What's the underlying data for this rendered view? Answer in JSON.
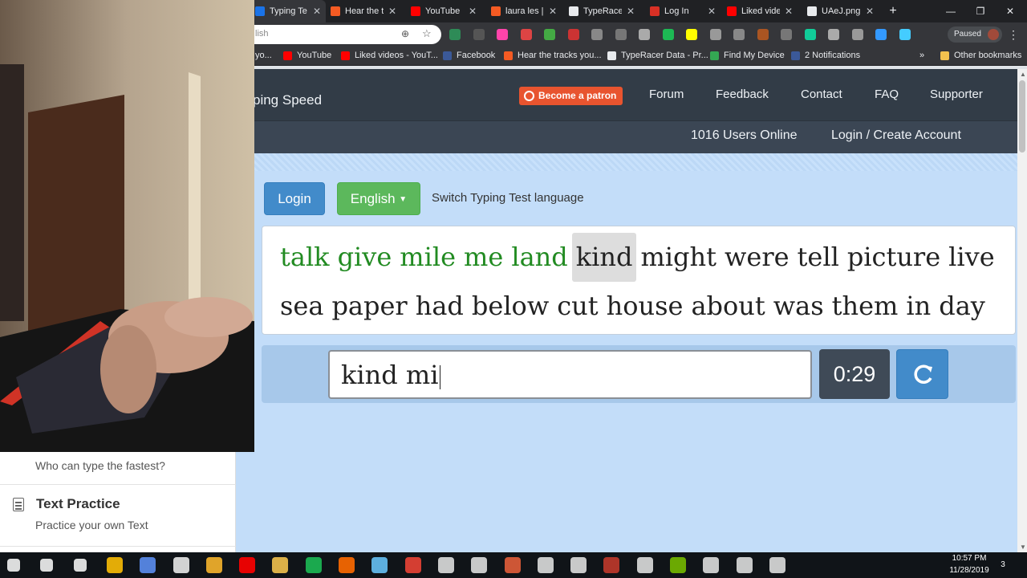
{
  "browser": {
    "tabs": [
      {
        "title": "Typing Te",
        "active": true,
        "color": "#1a73e8"
      },
      {
        "title": "Hear the t",
        "active": false,
        "color": "#f55b23"
      },
      {
        "title": "YouTube",
        "active": false,
        "color": "#ff0000"
      },
      {
        "title": "laura les |",
        "active": false,
        "color": "#f55b23"
      },
      {
        "title": "TypeRacer",
        "active": false,
        "color": "#e8eaed"
      },
      {
        "title": "Log In",
        "active": false,
        "color": "#d93025"
      },
      {
        "title": "Liked vide",
        "active": false,
        "color": "#ff0000"
      },
      {
        "title": "UAeJ.png",
        "active": false,
        "color": "#e8eaed"
      }
    ],
    "address_fragment": "lish",
    "profile_status": "Paused",
    "bookmarks": [
      {
        "label": "yo...",
        "color": "#ff0000"
      },
      {
        "label": "YouTube",
        "color": "#ff0000"
      },
      {
        "label": "Liked videos - YouT...",
        "color": "#ff0000"
      },
      {
        "label": "Facebook",
        "color": "#3b5998"
      },
      {
        "label": "Hear the tracks you...",
        "color": "#f55b23"
      },
      {
        "label": "TypeRacer Data - Pr...",
        "color": "#e8eaed"
      },
      {
        "label": "Find My Device",
        "color": "#34a853"
      },
      {
        "label": "2 Notifications",
        "color": "#3b5998"
      }
    ],
    "other_bookmarks": "Other bookmarks"
  },
  "site": {
    "brand": "ping Speed",
    "patron_label": "Become a patron",
    "nav": [
      "Forum",
      "Feedback",
      "Contact",
      "FAQ",
      "Supporter"
    ],
    "users_online": "1016 Users Online",
    "login_create": "Login / Create Account"
  },
  "controls": {
    "login_label": "Login",
    "language_label": "English",
    "language_note": "Switch Typing Test language"
  },
  "test": {
    "row1": [
      {
        "w": "talk",
        "s": "done"
      },
      {
        "w": "give",
        "s": "done"
      },
      {
        "w": "mile",
        "s": "done"
      },
      {
        "w": "me",
        "s": "done"
      },
      {
        "w": "land",
        "s": "done"
      },
      {
        "w": "kind",
        "s": "current"
      },
      {
        "w": "might",
        "s": "todo"
      },
      {
        "w": "were",
        "s": "todo"
      },
      {
        "w": "tell",
        "s": "todo"
      },
      {
        "w": "picture",
        "s": "todo"
      },
      {
        "w": "live",
        "s": "todo"
      }
    ],
    "row2": [
      {
        "w": "sea",
        "s": "todo"
      },
      {
        "w": "paper",
        "s": "todo"
      },
      {
        "w": "had",
        "s": "todo"
      },
      {
        "w": "below",
        "s": "todo"
      },
      {
        "w": "cut",
        "s": "todo"
      },
      {
        "w": "house",
        "s": "todo"
      },
      {
        "w": "about",
        "s": "todo"
      },
      {
        "w": "was",
        "s": "todo"
      },
      {
        "w": "them",
        "s": "todo"
      },
      {
        "w": "in",
        "s": "todo"
      },
      {
        "w": "day",
        "s": "todo"
      }
    ],
    "typed": "kind mi",
    "timer": "0:29"
  },
  "sidebar": {
    "competition_subtitle": "Who can type the fastest?",
    "practice_title": "Text Practice",
    "practice_subtitle": "Practice your own Text"
  },
  "taskbar": {
    "time": "10:57 PM",
    "date": "11/28/2019",
    "notifications": "3"
  }
}
